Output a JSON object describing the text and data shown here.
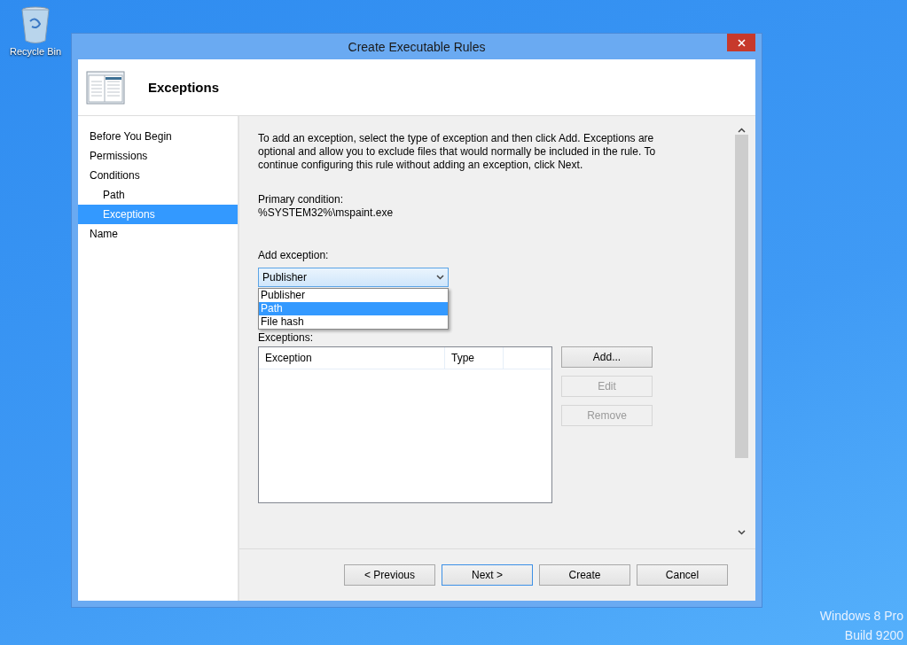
{
  "desktop": {
    "icon_label": "Recycle Bin",
    "watermark": [
      "Windows 8 Pro",
      "Build 9200"
    ]
  },
  "window": {
    "title": "Create Executable Rules",
    "header": "Exceptions"
  },
  "nav": [
    {
      "label": "Before You Begin",
      "selected": false
    },
    {
      "label": "Permissions",
      "selected": false
    },
    {
      "label": "Conditions",
      "selected": false,
      "children": [
        {
          "label": "Path",
          "selected": false
        },
        {
          "label": "Exceptions",
          "selected": true
        }
      ]
    },
    {
      "label": "Name",
      "selected": false
    }
  ],
  "description": "To add an exception, select the type of exception and then click Add. Exceptions are optional and allow you to exclude files that would normally be included in the rule. To continue configuring this rule without adding an exception, click Next.",
  "primary_condition": {
    "label": "Primary condition:",
    "value": "%SYSTEM32%\\mspaint.exe"
  },
  "add_exception": {
    "label": "Add exception:",
    "value": "Publisher",
    "options": [
      {
        "label": "Publisher",
        "highlighted": false
      },
      {
        "label": "Path",
        "highlighted": true
      },
      {
        "label": "File hash",
        "highlighted": false
      }
    ]
  },
  "exceptions": {
    "label": "Exceptions:",
    "columns": [
      "Exception",
      "Type"
    ]
  },
  "side_buttons": [
    {
      "label": "Add...",
      "disabled": false
    },
    {
      "label": "Edit",
      "disabled": true
    },
    {
      "label": "Remove",
      "disabled": true
    }
  ],
  "footer_buttons": [
    {
      "label": "< Previous",
      "default": false
    },
    {
      "label": "Next >",
      "default": true
    },
    {
      "label": "Create",
      "default": false
    },
    {
      "label": "Cancel",
      "default": false
    }
  ]
}
